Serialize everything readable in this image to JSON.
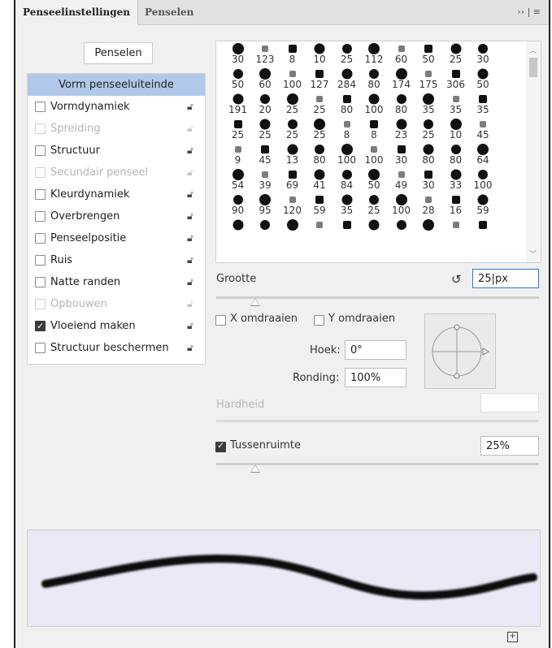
{
  "tabs": [
    {
      "label": "Penseelinstellingen",
      "active": true
    },
    {
      "label": "Penselen",
      "active": false
    }
  ],
  "tab_menu": "›› | ≡",
  "penselen_button": "Penselen",
  "left_list": [
    {
      "label": "Vorm penseeluiteinde",
      "type": "header",
      "selected": true
    },
    {
      "label": "Vormdynamiek",
      "checked": false,
      "disabled": false
    },
    {
      "label": "Spreiding",
      "checked": false,
      "disabled": true
    },
    {
      "label": "Structuur",
      "checked": false,
      "disabled": false
    },
    {
      "label": "Secundair penseel",
      "checked": false,
      "disabled": true
    },
    {
      "label": "Kleurdynamiek",
      "checked": false,
      "disabled": false
    },
    {
      "label": "Overbrengen",
      "checked": false,
      "disabled": false
    },
    {
      "label": "Penseelpositie",
      "checked": false,
      "disabled": false
    },
    {
      "label": "Ruis",
      "checked": false,
      "disabled": false
    },
    {
      "label": "Natte randen",
      "checked": false,
      "disabled": false
    },
    {
      "label": "Opbouwen",
      "checked": false,
      "disabled": true
    },
    {
      "label": "Vloeiend maken",
      "checked": true,
      "disabled": false
    },
    {
      "label": "Structuur beschermen",
      "checked": false,
      "disabled": false
    }
  ],
  "brush_grid": [
    [
      "30",
      "123",
      "8",
      "10",
      "25",
      "112",
      "60",
      "50",
      "25",
      "30"
    ],
    [
      "50",
      "60",
      "100",
      "127",
      "284",
      "80",
      "174",
      "175",
      "306",
      "50"
    ],
    [
      "191",
      "20",
      "25",
      "25",
      "80",
      "100",
      "80",
      "35",
      "35",
      "35"
    ],
    [
      "25",
      "25",
      "25",
      "25",
      "8",
      "8",
      "23",
      "25",
      "10",
      "45"
    ],
    [
      "9",
      "45",
      "13",
      "80",
      "100",
      "100",
      "30",
      "80",
      "80",
      "64"
    ],
    [
      "54",
      "39",
      "69",
      "41",
      "84",
      "50",
      "49",
      "30",
      "33",
      "100"
    ],
    [
      "90",
      "95",
      "120",
      "59",
      "35",
      "25",
      "100",
      "28",
      "16",
      "59"
    ],
    [
      "",
      "",
      "",
      "",
      "",
      "",
      "",
      "",
      "",
      ""
    ]
  ],
  "size": {
    "label": "Grootte",
    "value": "25",
    "unit": "px",
    "slider_fraction": 0.12
  },
  "flip_x": {
    "label": "X omdraaien",
    "checked": false
  },
  "flip_y": {
    "label": "Y omdraaien",
    "checked": false
  },
  "angle": {
    "label": "Hoek:",
    "value": "0°"
  },
  "roundness": {
    "label": "Ronding:",
    "value": "100%"
  },
  "hardness": {
    "label": "Hardheid",
    "value": ""
  },
  "spacing": {
    "label": "Tussenruimte",
    "checked": true,
    "value": "25%",
    "slider_fraction": 0.12
  },
  "icons": {
    "lock": "lock-icon",
    "reset": "reset-icon",
    "new_brush": "add-icon",
    "menu": "menu-icon"
  },
  "colors": {
    "selected_row": "#b0c9ea",
    "preview_bg": "#ece8f6",
    "focus_border": "#2d78d0"
  }
}
